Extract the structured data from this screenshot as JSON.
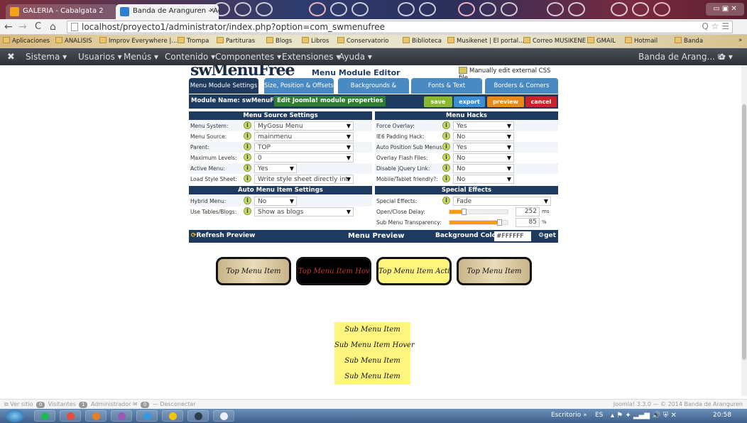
{
  "browser": {
    "tabs": [
      {
        "title": "GALERIA - Cabalgata 2"
      },
      {
        "title": "Banda de Aranguren - Ad",
        "close": "×"
      }
    ],
    "window_controls": "▭ ▣ ✕",
    "nav": {
      "back": "←",
      "forward": "→",
      "reload": "C",
      "home": "⌂"
    },
    "url": "localhost/proyecto1/administrator/index.php?option=com_swmenufree",
    "url_icons": "Q ☆ ☰",
    "bookmarks": [
      "Aplicaciones",
      "ANALISIS",
      "Improv Everywhere |...",
      "Trompa",
      "Partituras",
      "Blogs",
      "Libros",
      "Conservatorio",
      "Biblioteca",
      "Musikenet | El portal...",
      "Correo MUSIKENE",
      "GMAIL",
      "Hotmail",
      "Banda"
    ],
    "bookmark_more": "»"
  },
  "joomla_bar": {
    "menus": [
      "Sistema ▾",
      "Usuarios ▾",
      "Menús ▾",
      "Contenido ▾",
      "Componentes ▾",
      "Extensiones ▾",
      "Ayuda ▾"
    ],
    "site": "Banda de Arang...",
    "site_icon": "⧉",
    "gear": "✿ ▾"
  },
  "editor": {
    "logo": "swMenuFree",
    "title": "Menu Module Editor",
    "manual_css": "Manually edit external CSS file",
    "tabs": [
      {
        "label": "Menu Module Settings",
        "color": "#1e3a5f"
      },
      {
        "label": "Size, Position & Offsets",
        "color": "#4a8ac2"
      },
      {
        "label": "Backgrounds & Indicators",
        "color": "#4a8ac2"
      },
      {
        "label": "Fonts & Text",
        "color": "#4a8ac2"
      },
      {
        "label": "Borders & Corners",
        "color": "#4a8ac2"
      }
    ],
    "module_name": "Module Name: swMenuFree",
    "edit_props": "Edit Joomla! module properties",
    "actions": [
      {
        "label": "save",
        "color": "#8ab833"
      },
      {
        "label": "export",
        "color": "#3b8fd0"
      },
      {
        "label": "preview",
        "color": "#e88a1a"
      },
      {
        "label": "cancel",
        "color": "#c9242b"
      }
    ],
    "menu_source": {
      "header": "Menu Source Settings",
      "rows": [
        {
          "label": "Menu System:",
          "value": "MyGosu Menu"
        },
        {
          "label": "Menu Source:",
          "value": "mainmenu"
        },
        {
          "label": "Parent:",
          "value": "TOP"
        },
        {
          "label": "Maximum Levels:",
          "value": "0"
        },
        {
          "label": "Active Menu:",
          "value": "Yes"
        },
        {
          "label": "Load Style Sheet:",
          "value": "Write style sheet directly int"
        }
      ]
    },
    "menu_hacks": {
      "header": "Menu Hacks",
      "rows": [
        {
          "label": "Force Overlay:",
          "value": "Yes"
        },
        {
          "label": "IE6 Padding Hack:",
          "value": "No"
        },
        {
          "label": "Auto Position Sub Menus:",
          "value": "Yes"
        },
        {
          "label": "Overlay Flash Files:",
          "value": "No"
        },
        {
          "label": "Disable jQuery Link:",
          "value": "No"
        },
        {
          "label": "Mobile/Tablet friendly?:",
          "value": "No"
        }
      ]
    },
    "auto_menu": {
      "header": "Auto Menu Item Settings",
      "rows": [
        {
          "label": "Hybrid Menu:",
          "value": "No"
        },
        {
          "label": "Use Tables/Blogs:",
          "value": "Show as blogs"
        }
      ]
    },
    "special_effects": {
      "header": "Special Effects",
      "effect_label": "Special Effects:",
      "effect_value": "Fade",
      "delay_label": "Open/Close Delay:",
      "delay_value": "252",
      "delay_unit": "ms",
      "delay_fraction": 0.25,
      "transp_label": "Sub Menu Transparency:",
      "transp_value": "85",
      "transp_unit": "%",
      "transp_fraction": 0.85
    },
    "preview": {
      "refresh": "Refresh Preview",
      "title": "Menu Preview",
      "bg_label": "Background Color:",
      "bg_value": "#FFFFFF",
      "get": "get",
      "top_items": [
        "Top Menu Item",
        "Top Menu Item Hover",
        "Top Menu Item Active",
        "Top Menu Item"
      ],
      "sub_items": [
        "Sub Menu Item",
        "Sub Menu Item Hover",
        "Sub Menu Item",
        "Sub Menu Item"
      ]
    }
  },
  "status_bar": {
    "left": [
      "Ver sitio",
      "Visitantes",
      "Administrador",
      "Desconectar"
    ],
    "counts": [
      "0",
      "1",
      "0"
    ],
    "right": "Joomla! 3.3.0 — © 2014 Banda de Aranguren"
  },
  "taskbar": {
    "desktop": "Escritorio",
    "more": "»",
    "lang": "ES",
    "time": "20:58"
  }
}
